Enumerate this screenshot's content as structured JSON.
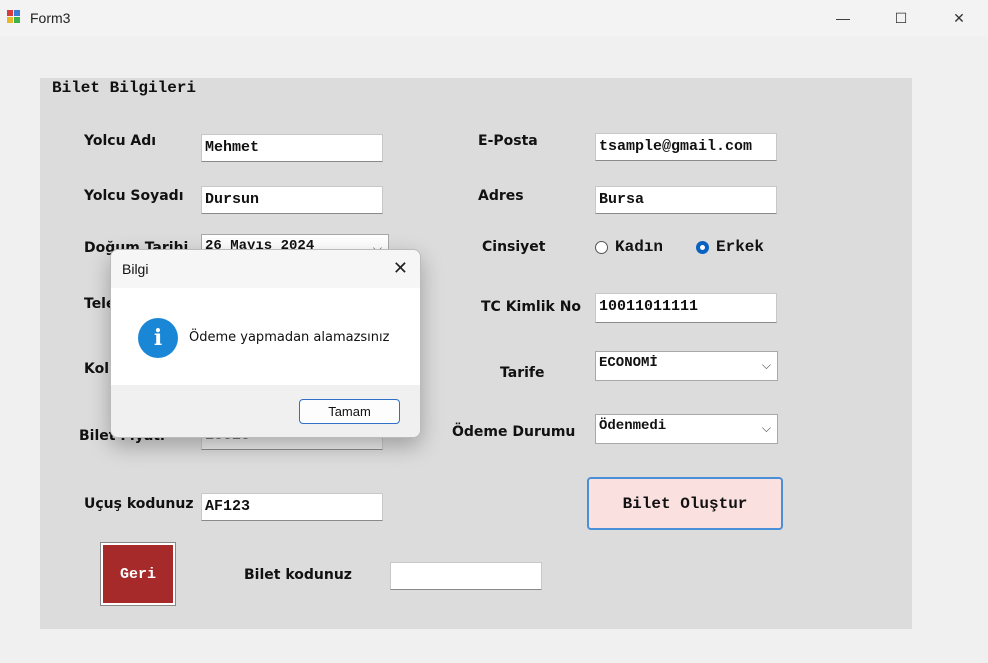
{
  "window": {
    "title": "Form3",
    "minimize_glyph": "—",
    "maximize_glyph": "☐",
    "close_glyph": "✕"
  },
  "group": {
    "title": "Bilet Bilgileri"
  },
  "labels": {
    "yolcu_adi": "Yolcu Adı",
    "yolcu_soyadi": "Yolcu Soyadı",
    "dogum_tarihi": "Doğum Tarihi",
    "telefon": "Tele",
    "koltuk": "Kol",
    "bilet_fiyati": "Bilet Fiyatı",
    "ucus_kodu": "Uçuş kodunuz",
    "bilet_kodu": "Bilet  kodunuz",
    "eposta": "E-Posta",
    "adres": "Adres",
    "cinsiyet": "Cinsiyet",
    "tc": "TC Kimlik No",
    "tarife": "Tarife",
    "odeme": "Ödeme Durumu"
  },
  "fields": {
    "yolcu_adi": "Mehmet",
    "yolcu_soyadi": "Dursun",
    "dogum_tarihi": "26   Mayıs   2024",
    "bilet_fiyati": "10020",
    "ucus_kodu": "AF123",
    "bilet_kodu": "",
    "eposta": "tsample@gmail.com",
    "adres": "Bursa",
    "tc": "10011011111",
    "tarife": "ECONOMİ",
    "odeme": "Ödenmedi"
  },
  "gender": {
    "female": "Kadın",
    "male": "Erkek",
    "selected": "Erkek"
  },
  "buttons": {
    "create": "Bilet Oluştur",
    "back": "Geri"
  },
  "dialog": {
    "title": "Bilgi",
    "close_glyph": "✕",
    "message": "Ödeme yapmadan alamazsınız",
    "ok": "Tamam",
    "icon": "info-icon"
  }
}
